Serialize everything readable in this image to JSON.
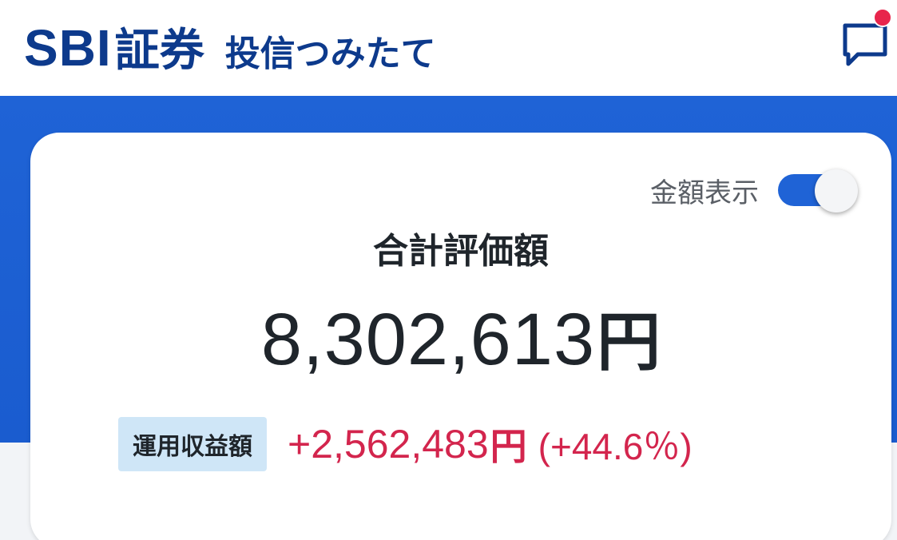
{
  "header": {
    "brand_latin": "SBI",
    "brand_kanji": "証券",
    "subtitle": "投信つみたて",
    "chat_icon": "chat-bubble-icon",
    "notification_color": "#e8254c"
  },
  "summary": {
    "toggle_label": "金額表示",
    "toggle_on": true,
    "total_label": "合計評価額",
    "total_amount": "8,302,613",
    "total_unit": "円",
    "profit_label": "運用収益額",
    "profit_amount": "+2,562,483",
    "profit_unit": "円",
    "profit_percent": "(+44.6％)"
  },
  "colors": {
    "brand": "#0d3a8c",
    "accent_blue": "#1f63d6",
    "profit": "#d3254d",
    "badge_bg": "#cfe6f7"
  }
}
